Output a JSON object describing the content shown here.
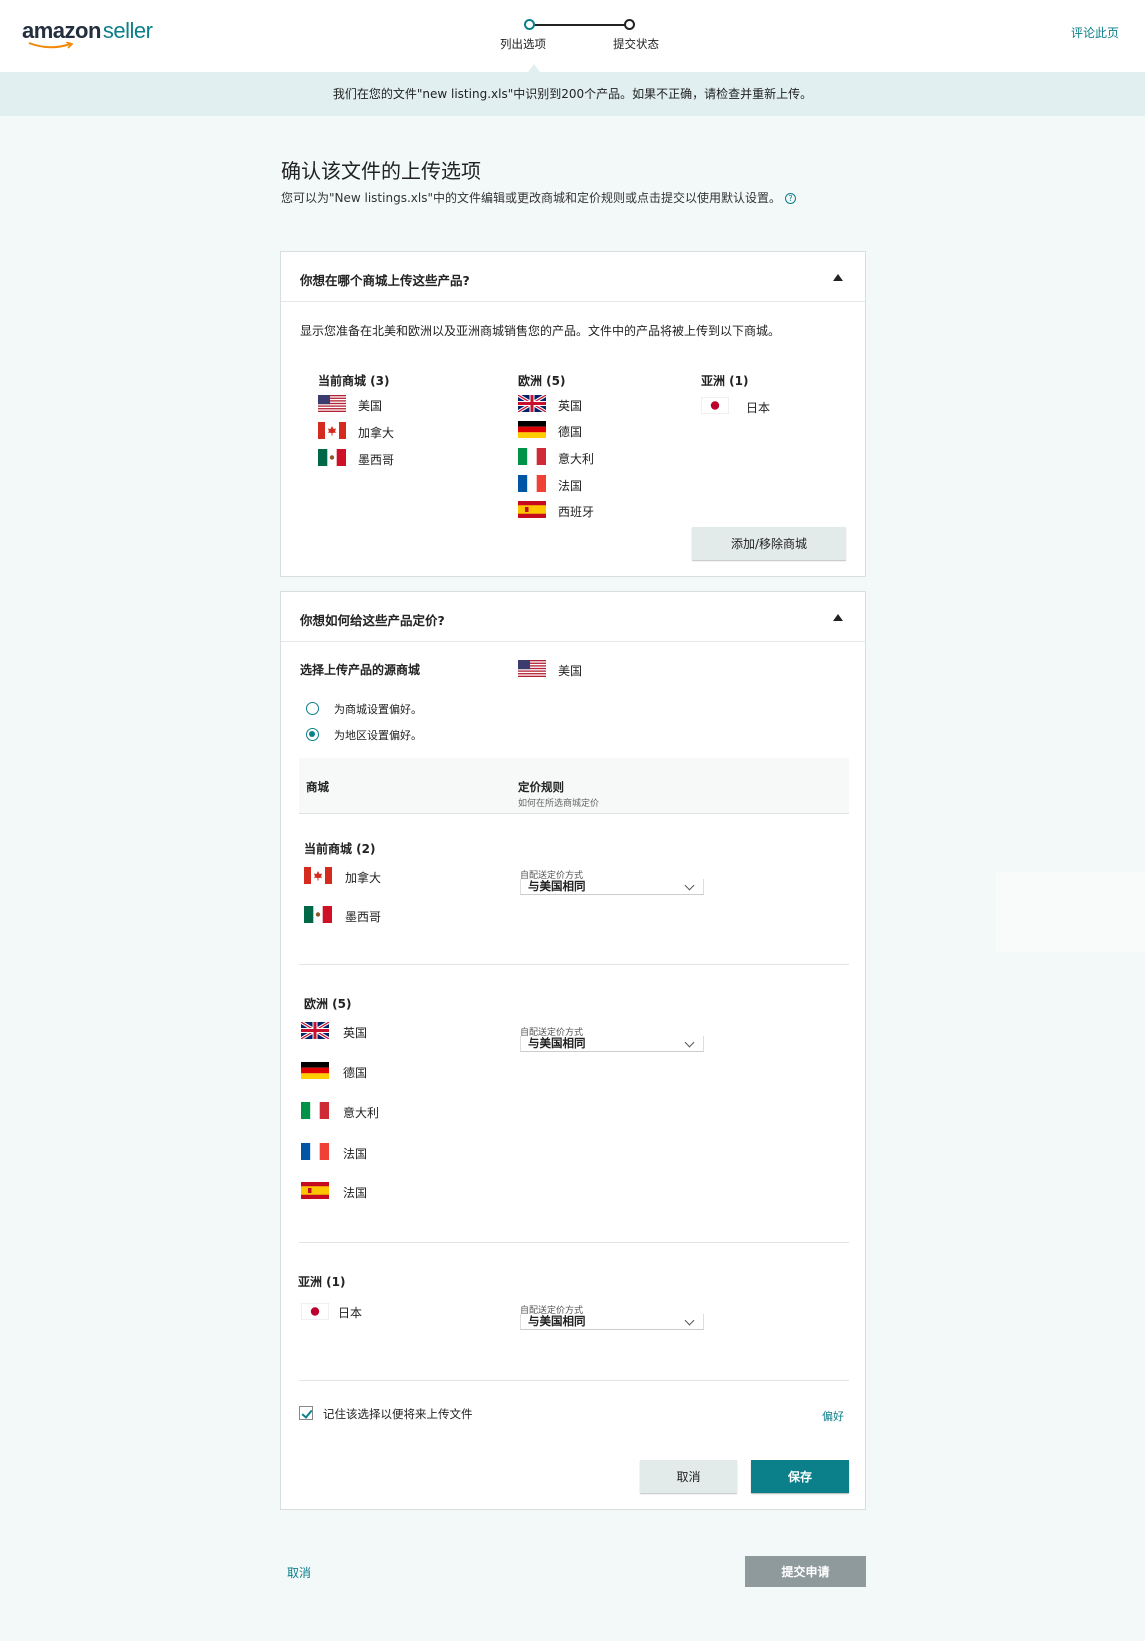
{
  "header": {
    "logo_main": "amazon",
    "logo_sub": "seller",
    "review_link": "评论此页",
    "steps": [
      "列出选项",
      "提交状态"
    ]
  },
  "notice": "我们在您的文件\"new listing.xls\"中识别到200个产品。如果不正确，请检查并重新上传。",
  "page": {
    "title": "确认该文件的上传选项",
    "subtitle": "您可以为\"New listings.xls\"中的文件编辑或更改商城和定价规则或点击提交以使用默认设置。",
    "help_glyph": "?"
  },
  "marketplace_card": {
    "title": "你想在哪个商城上传这些产品?",
    "description": "显示您准备在北美和欧洲以及亚洲商城销售您的产品。文件中的产品将被上传到以下商城。",
    "groups": [
      {
        "heading": "当前商城 (3)",
        "items": [
          {
            "flag": "us",
            "name": "美国"
          },
          {
            "flag": "ca",
            "name": "加拿大"
          },
          {
            "flag": "mx",
            "name": "墨西哥"
          }
        ]
      },
      {
        "heading": "欧洲 (5)",
        "items": [
          {
            "flag": "uk",
            "name": "英国"
          },
          {
            "flag": "de",
            "name": "德国"
          },
          {
            "flag": "it",
            "name": "意大利"
          },
          {
            "flag": "fr",
            "name": "法国"
          },
          {
            "flag": "es",
            "name": "西班牙"
          }
        ]
      },
      {
        "heading": "亚洲 (1)",
        "items": [
          {
            "flag": "jp",
            "name": "日本"
          }
        ]
      }
    ],
    "add_remove_button": "添加/移除商城"
  },
  "pricing_card": {
    "title": "你想如何给这些产品定价?",
    "source_label": "选择上传产品的源商城",
    "source_value": {
      "flag": "us",
      "name": "美国"
    },
    "radio_options": [
      {
        "label": "为商城设置偏好。",
        "selected": false
      },
      {
        "label": "为地区设置偏好。",
        "selected": true
      }
    ],
    "table_headers": {
      "marketplace": "商城",
      "rule": "定价规则",
      "rule_sub": "如何在所选商城定价"
    },
    "select_caption": "自配送定价方式",
    "select_value": "与美国相同",
    "groups": [
      {
        "heading": "当前商城 (2)",
        "items": [
          {
            "flag": "ca",
            "name": "加拿大"
          },
          {
            "flag": "mx",
            "name": "墨西哥"
          }
        ]
      },
      {
        "heading": "欧洲 (5)",
        "items": [
          {
            "flag": "uk",
            "name": "英国"
          },
          {
            "flag": "de",
            "name": "德国"
          },
          {
            "flag": "it",
            "name": "意大利"
          },
          {
            "flag": "fr",
            "name": "法国"
          },
          {
            "flag": "es",
            "name": "法国"
          }
        ]
      },
      {
        "heading": "亚洲 (1)",
        "items": [
          {
            "flag": "jp",
            "name": "日本"
          }
        ]
      }
    ],
    "remember_label": "记住该选择以便将来上传文件",
    "remember_checked": true,
    "preferences_link": "偏好",
    "cancel_button": "取消",
    "save_button": "保存"
  },
  "footer": {
    "cancel_link": "取消",
    "submit_button": "提交申请"
  },
  "colors": {
    "accent": "#0b7f8a",
    "notice_bg": "#e1eff1",
    "page_bg": "#f3f8f8",
    "disabled_button": "#8f9a9c"
  }
}
